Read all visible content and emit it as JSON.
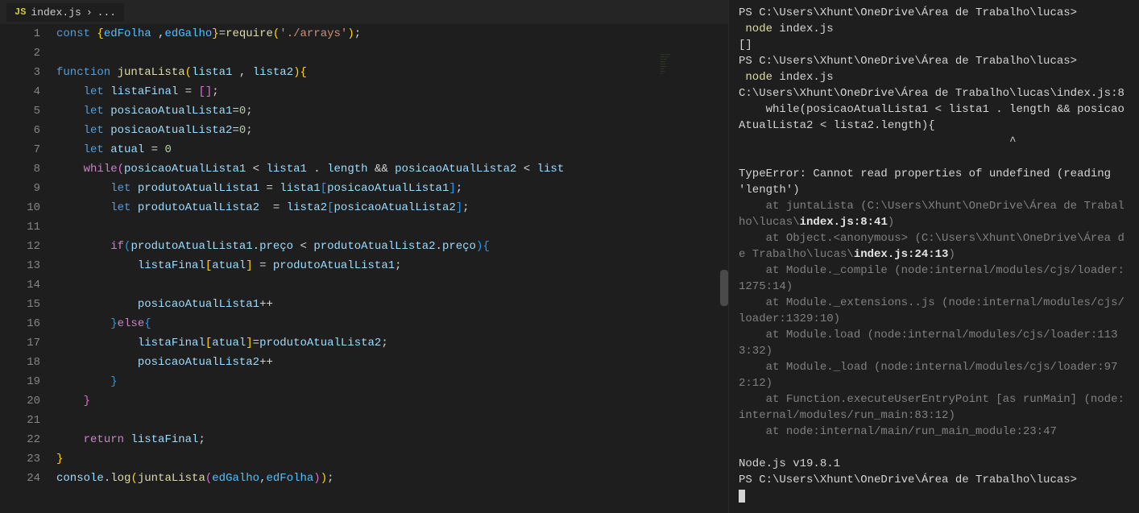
{
  "tab": {
    "icon_label": "JS",
    "filename": "index.js",
    "breadcrumb_sep": "›",
    "breadcrumb_tail": "..."
  },
  "code": {
    "line_count": 24,
    "lines_tokens": [
      [
        [
          "c-kw",
          "const"
        ],
        [
          "c-punc",
          " "
        ],
        [
          "c-brace1",
          "{"
        ],
        [
          "c-const",
          "edFolha"
        ],
        [
          "c-punc",
          " ,"
        ],
        [
          "c-const",
          "edGalho"
        ],
        [
          "c-brace1",
          "}"
        ],
        [
          "c-punc",
          "="
        ],
        [
          "c-fn",
          "require"
        ],
        [
          "c-brace1",
          "("
        ],
        [
          "c-str",
          "'./arrays'"
        ],
        [
          "c-brace1",
          ")"
        ],
        [
          "c-punc",
          ";"
        ]
      ],
      [],
      [
        [
          "c-kw",
          "function"
        ],
        [
          "c-punc",
          " "
        ],
        [
          "c-fn",
          "juntaLista"
        ],
        [
          "c-brace1",
          "("
        ],
        [
          "c-var",
          "lista1"
        ],
        [
          "c-punc",
          " , "
        ],
        [
          "c-var",
          "lista2"
        ],
        [
          "c-brace1",
          ")"
        ],
        [
          "c-brace1",
          "{"
        ]
      ],
      [
        [
          "c-punc",
          "    "
        ],
        [
          "c-kw",
          "let"
        ],
        [
          "c-punc",
          " "
        ],
        [
          "c-var",
          "listaFinal"
        ],
        [
          "c-punc",
          " = "
        ],
        [
          "c-brace2",
          "["
        ],
        [
          "c-brace2",
          "]"
        ],
        [
          "c-punc",
          ";"
        ]
      ],
      [
        [
          "c-punc",
          "    "
        ],
        [
          "c-kw",
          "let"
        ],
        [
          "c-punc",
          " "
        ],
        [
          "c-var",
          "posicaoAtualLista1"
        ],
        [
          "c-punc",
          "="
        ],
        [
          "c-num",
          "0"
        ],
        [
          "c-punc",
          ";"
        ]
      ],
      [
        [
          "c-punc",
          "    "
        ],
        [
          "c-kw",
          "let"
        ],
        [
          "c-punc",
          " "
        ],
        [
          "c-var",
          "posicaoAtualLista2"
        ],
        [
          "c-punc",
          "="
        ],
        [
          "c-num",
          "0"
        ],
        [
          "c-punc",
          ";"
        ]
      ],
      [
        [
          "c-punc",
          "    "
        ],
        [
          "c-kw",
          "let"
        ],
        [
          "c-punc",
          " "
        ],
        [
          "c-var",
          "atual"
        ],
        [
          "c-punc",
          " = "
        ],
        [
          "c-num",
          "0"
        ]
      ],
      [
        [
          "c-punc",
          "    "
        ],
        [
          "c-kw2",
          "while"
        ],
        [
          "c-brace2",
          "("
        ],
        [
          "c-var",
          "posicaoAtualLista1"
        ],
        [
          "c-punc",
          " < "
        ],
        [
          "c-var",
          "lista1"
        ],
        [
          "c-punc",
          " . "
        ],
        [
          "c-var",
          "length"
        ],
        [
          "c-punc",
          " && "
        ],
        [
          "c-var",
          "posicaoAtualLista2"
        ],
        [
          "c-punc",
          " < "
        ],
        [
          "c-var",
          "list"
        ]
      ],
      [
        [
          "c-punc",
          "        "
        ],
        [
          "c-kw",
          "let"
        ],
        [
          "c-punc",
          " "
        ],
        [
          "c-var",
          "produtoAtualLista1"
        ],
        [
          "c-punc",
          " = "
        ],
        [
          "c-var",
          "lista1"
        ],
        [
          "c-brace3",
          "["
        ],
        [
          "c-var",
          "posicaoAtualLista1"
        ],
        [
          "c-brace3",
          "]"
        ],
        [
          "c-punc",
          ";"
        ]
      ],
      [
        [
          "c-punc",
          "        "
        ],
        [
          "c-kw",
          "let"
        ],
        [
          "c-punc",
          " "
        ],
        [
          "c-var",
          "produtoAtualLista2"
        ],
        [
          "c-punc",
          "  = "
        ],
        [
          "c-var",
          "lista2"
        ],
        [
          "c-brace3",
          "["
        ],
        [
          "c-var",
          "posicaoAtualLista2"
        ],
        [
          "c-brace3",
          "]"
        ],
        [
          "c-punc",
          ";"
        ]
      ],
      [],
      [
        [
          "c-punc",
          "        "
        ],
        [
          "c-kw2",
          "if"
        ],
        [
          "c-brace3",
          "("
        ],
        [
          "c-var",
          "produtoAtualLista1"
        ],
        [
          "c-punc",
          "."
        ],
        [
          "c-var",
          "preço"
        ],
        [
          "c-punc",
          " < "
        ],
        [
          "c-var",
          "produtoAtualLista2"
        ],
        [
          "c-punc",
          "."
        ],
        [
          "c-var",
          "preço"
        ],
        [
          "c-brace3",
          ")"
        ],
        [
          "c-brace3",
          "{"
        ]
      ],
      [
        [
          "c-punc",
          "            "
        ],
        [
          "c-var",
          "listaFinal"
        ],
        [
          "c-brace1",
          "["
        ],
        [
          "c-var",
          "atual"
        ],
        [
          "c-brace1",
          "]"
        ],
        [
          "c-punc",
          " = "
        ],
        [
          "c-var",
          "produtoAtualLista1"
        ],
        [
          "c-punc",
          ";"
        ]
      ],
      [],
      [
        [
          "c-punc",
          "            "
        ],
        [
          "c-var",
          "posicaoAtualLista1"
        ],
        [
          "c-punc",
          "++"
        ]
      ],
      [
        [
          "c-punc",
          "        "
        ],
        [
          "c-brace3",
          "}"
        ],
        [
          "c-kw2",
          "else"
        ],
        [
          "c-brace3",
          "{"
        ]
      ],
      [
        [
          "c-punc",
          "            "
        ],
        [
          "c-var",
          "listaFinal"
        ],
        [
          "c-brace1",
          "["
        ],
        [
          "c-var",
          "atual"
        ],
        [
          "c-brace1",
          "]"
        ],
        [
          "c-punc",
          "="
        ],
        [
          "c-var",
          "produtoAtualLista2"
        ],
        [
          "c-punc",
          ";"
        ]
      ],
      [
        [
          "c-punc",
          "            "
        ],
        [
          "c-var",
          "posicaoAtualLista2"
        ],
        [
          "c-punc",
          "++"
        ]
      ],
      [
        [
          "c-punc",
          "        "
        ],
        [
          "c-brace3",
          "}"
        ]
      ],
      [
        [
          "c-punc",
          "    "
        ],
        [
          "c-brace2",
          "}"
        ]
      ],
      [],
      [
        [
          "c-punc",
          "    "
        ],
        [
          "c-kw2",
          "return"
        ],
        [
          "c-punc",
          " "
        ],
        [
          "c-var",
          "listaFinal"
        ],
        [
          "c-punc",
          ";"
        ]
      ],
      [
        [
          "c-brace1",
          "}"
        ]
      ],
      [
        [
          "c-var",
          "console"
        ],
        [
          "c-punc",
          "."
        ],
        [
          "c-fn",
          "log"
        ],
        [
          "c-brace1",
          "("
        ],
        [
          "c-fn",
          "juntaLista"
        ],
        [
          "c-brace2",
          "("
        ],
        [
          "c-const",
          "edGalho"
        ],
        [
          "c-punc",
          ","
        ],
        [
          "c-const",
          "edFolha"
        ],
        [
          "c-brace2",
          ")"
        ],
        [
          "c-brace1",
          ")"
        ],
        [
          "c-punc",
          ";"
        ]
      ]
    ]
  },
  "terminal": {
    "lines": [
      [
        [
          "t-white",
          "PS C:\\Users\\Xhunt\\OneDrive\\Área de Trabalho\\lucas> "
        ]
      ],
      [
        [
          "t-yellow",
          " node "
        ],
        [
          "t-white",
          "index.js"
        ]
      ],
      [
        [
          "t-white",
          "[]"
        ]
      ],
      [
        [
          "t-white",
          "PS C:\\Users\\Xhunt\\OneDrive\\Área de Trabalho\\lucas> "
        ]
      ],
      [
        [
          "t-yellow",
          " node "
        ],
        [
          "t-white",
          "index.js"
        ]
      ],
      [
        [
          "t-white",
          "C:\\Users\\Xhunt\\OneDrive\\Área de Trabalho\\lucas\\index.js:8"
        ]
      ],
      [
        [
          "t-white",
          "    while(posicaoAtualLista1 < lista1 . length && posicaoAtualLista2 < lista2.length){"
        ]
      ],
      [
        [
          "t-white",
          "                                        ^"
        ]
      ],
      [],
      [
        [
          "t-white",
          "TypeError: Cannot read properties of undefined (reading 'length')"
        ]
      ],
      [
        [
          "t-gray",
          "    at juntaLista (C:\\Users\\Xhunt\\OneDrive\\Área de Trabalho\\lucas\\"
        ],
        [
          "t-bold",
          "index.js:8:41"
        ],
        [
          "t-gray",
          ")"
        ]
      ],
      [
        [
          "t-gray",
          "    at Object.<anonymous> (C:\\Users\\Xhunt\\OneDrive\\Área de Trabalho\\lucas\\"
        ],
        [
          "t-bold",
          "index.js:24:13"
        ],
        [
          "t-gray",
          ")"
        ]
      ],
      [
        [
          "t-gray",
          "    at Module._compile (node:internal/modules/cjs/loader:1275:14)"
        ]
      ],
      [
        [
          "t-gray",
          "    at Module._extensions..js (node:internal/modules/cjs/loader:1329:10)"
        ]
      ],
      [
        [
          "t-gray",
          "    at Module.load (node:internal/modules/cjs/loader:1133:32)"
        ]
      ],
      [
        [
          "t-gray",
          "    at Module._load (node:internal/modules/cjs/loader:972:12)"
        ]
      ],
      [
        [
          "t-gray",
          "    at Function.executeUserEntryPoint [as runMain] (node:internal/modules/run_main:83:12)"
        ]
      ],
      [
        [
          "t-gray",
          "    at node:internal/main/run_main_module:23:47"
        ]
      ],
      [],
      [
        [
          "t-white",
          "Node.js v19.8.1"
        ]
      ],
      [
        [
          "t-white",
          "PS C:\\Users\\Xhunt\\OneDrive\\Área de Trabalho\\lucas> "
        ]
      ],
      [
        [
          "cursor",
          ""
        ]
      ]
    ]
  }
}
